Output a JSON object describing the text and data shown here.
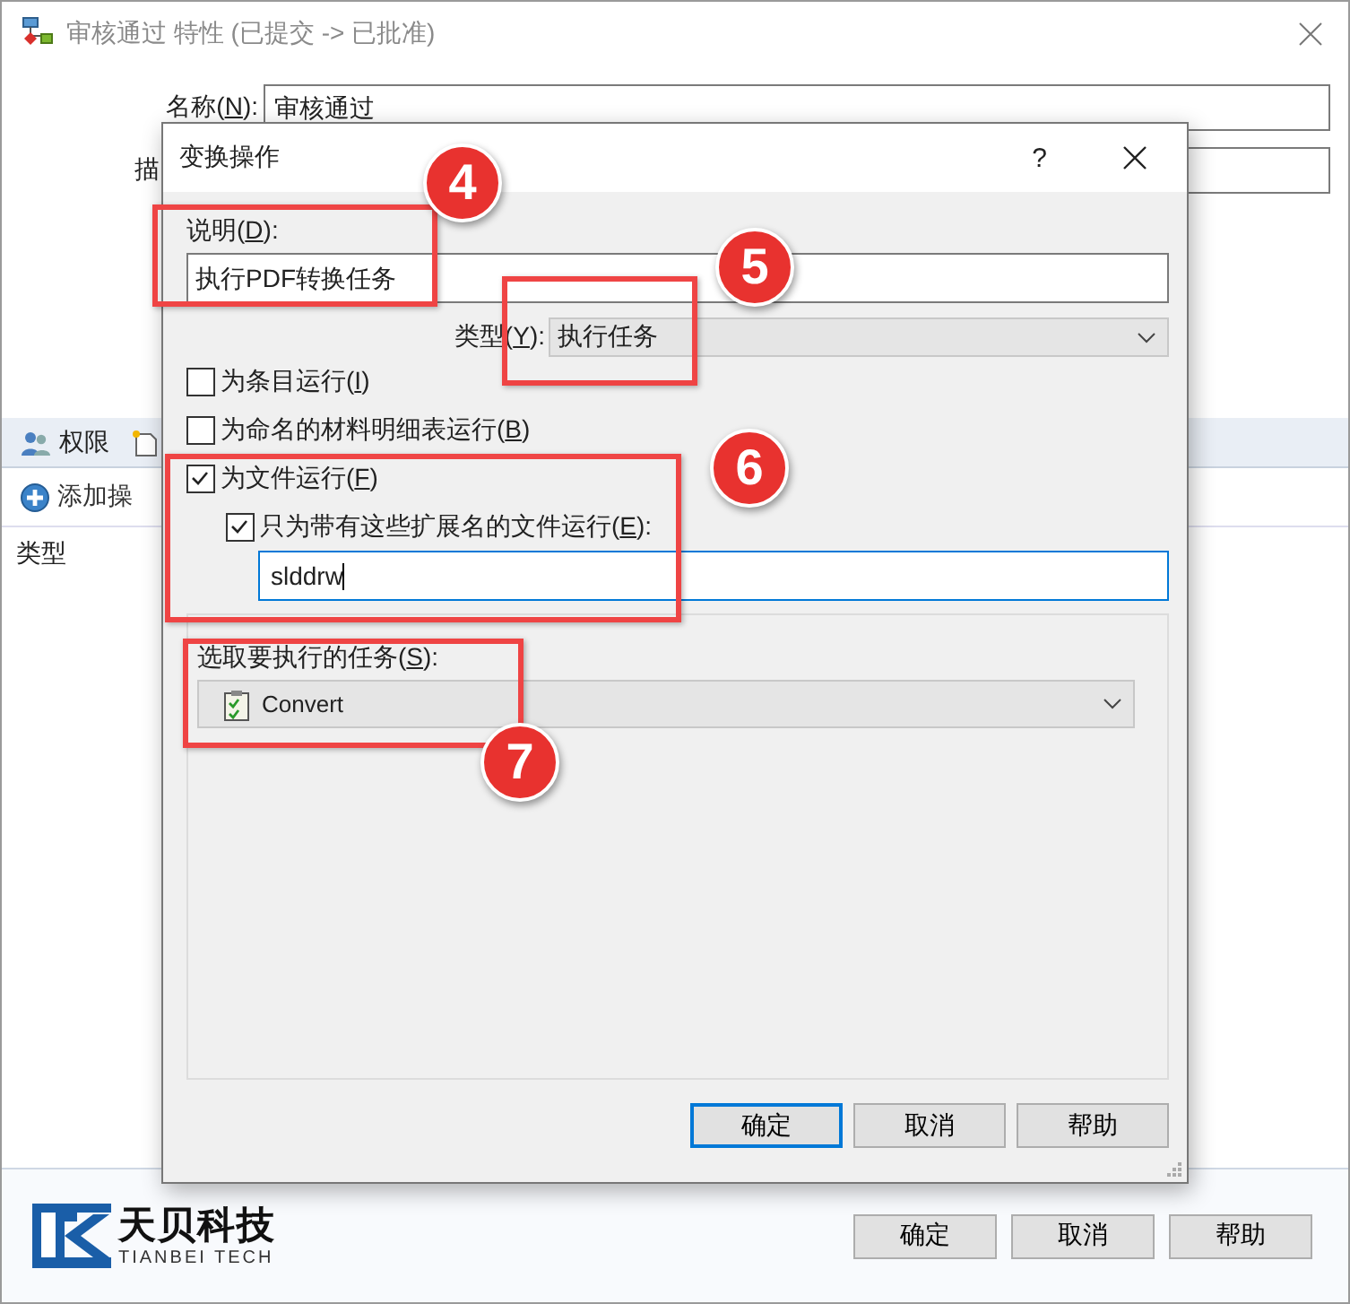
{
  "window": {
    "title": "审核通过 特性 (已提交 -> 已批准)"
  },
  "fields": [
    {
      "label": {
        "before": "名称(",
        "key": "N",
        "after": "):"
      },
      "value": "审核通过"
    },
    {
      "label": {
        "before": "描"
      }
    }
  ],
  "tabs": [
    {
      "label": "权限"
    }
  ],
  "toolbar": {
    "add": "添加操"
  },
  "list": {
    "columns": [
      "类型"
    ]
  },
  "logo": {
    "name": "天贝科技",
    "subtitle": "TIANBEI TECH"
  },
  "buttons": [
    "确定",
    "取消",
    "帮助"
  ],
  "dialog": {
    "title": "变换操作",
    "help": "?",
    "description": {
      "label": {
        "before": "说明(",
        "key": "D",
        "after": "):"
      },
      "value": "执行PDF转换任务"
    },
    "type": {
      "label": {
        "before": "类型(",
        "key": "Y",
        "after": "):"
      },
      "value": "执行任务"
    },
    "checkboxes": [
      {
        "label": {
          "before": "为条目运行(",
          "key": "I",
          "after": ")"
        },
        "checked": false
      },
      {
        "label": {
          "before": "为命名的材料明细表运行(",
          "key": "B",
          "after": ")"
        },
        "checked": false
      },
      {
        "label": {
          "before": "为文件运行(",
          "key": "F",
          "after": ")"
        },
        "checked": true,
        "children": [
          {
            "label": {
              "before": "只为带有这些扩展名的文件运行(",
              "key": "E",
              "after": "):"
            },
            "checked": true
          }
        ]
      }
    ],
    "extensions": "slddrw",
    "task": {
      "label": {
        "before": "选取要执行的任务(",
        "key": "S",
        "after": "):"
      },
      "value": "Convert"
    },
    "buttons": [
      {
        "label": "确定",
        "focused": true
      },
      {
        "label": "取消",
        "focused": false
      },
      {
        "label": "帮助",
        "focused": false
      }
    ]
  },
  "annotations": [
    {
      "number": "4"
    },
    {
      "number": "5"
    },
    {
      "number": "6"
    },
    {
      "number": "7"
    }
  ]
}
